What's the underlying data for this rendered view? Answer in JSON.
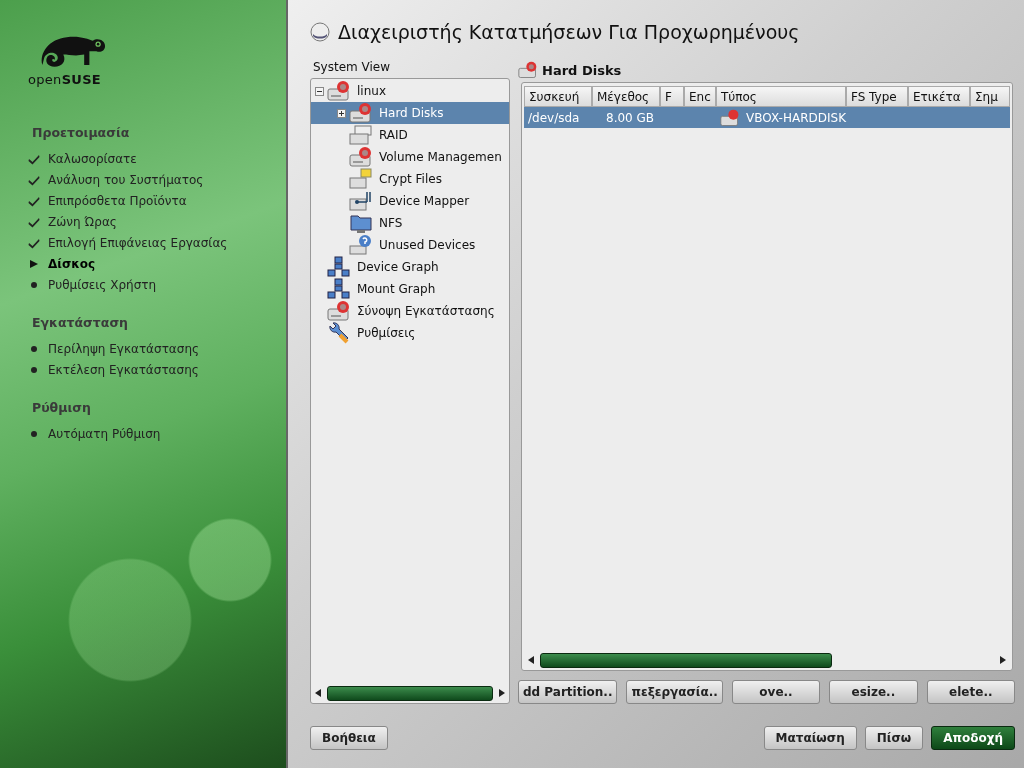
{
  "sidebar": {
    "logo_text": "open**SUSE**",
    "sections": [
      {
        "title": "Προετοιμασία",
        "items": [
          {
            "label": "Καλωσορίσατε",
            "done": true,
            "current": false
          },
          {
            "label": "Ανάλυση του Συστήματος",
            "done": true,
            "current": false
          },
          {
            "label": "Επιπρόσθετα Προϊόντα",
            "done": true,
            "current": false
          },
          {
            "label": "Ζώνη Ώρας",
            "done": true,
            "current": false
          },
          {
            "label": "Επιλογή Επιφάνειας Εργασίας",
            "done": true,
            "current": false
          },
          {
            "label": "Δίσκος",
            "done": false,
            "current": true
          },
          {
            "label": "Ρυθμίσεις Χρήστη",
            "done": false,
            "current": false
          }
        ]
      },
      {
        "title": "Εγκατάσταση",
        "items": [
          {
            "label": "Περίληψη Εγκατάστασης",
            "done": false,
            "current": false
          },
          {
            "label": "Εκτέλεση Εγκατάστασης",
            "done": false,
            "current": false
          }
        ]
      },
      {
        "title": "Ρύθμιση",
        "items": [
          {
            "label": "Αυτόματη Ρύθμιση",
            "done": false,
            "current": false
          }
        ]
      }
    ]
  },
  "window": {
    "title": "Διαχειριστής Κατατμήσεων Για Προχωρημένους"
  },
  "system_view": {
    "label": "System View",
    "tree": [
      {
        "label": "linux",
        "kind": "disk",
        "expanded": true,
        "selected": false,
        "children": [
          {
            "label": "Hard Disks",
            "kind": "disk",
            "expanded": false,
            "selected": true
          },
          {
            "label": "RAID",
            "kind": "raid",
            "selected": false
          },
          {
            "label": "Volume Managemen",
            "kind": "volume",
            "selected": false
          },
          {
            "label": "Crypt Files",
            "kind": "crypt",
            "selected": false
          },
          {
            "label": "Device Mapper",
            "kind": "mapper",
            "selected": false
          },
          {
            "label": "NFS",
            "kind": "nfs",
            "selected": false
          },
          {
            "label": "Unused Devices",
            "kind": "unused",
            "selected": false
          }
        ]
      },
      {
        "label": "Device Graph",
        "kind": "graph",
        "selected": false
      },
      {
        "label": "Mount Graph",
        "kind": "graph",
        "selected": false
      },
      {
        "label": "Σύνοψη Εγκατάστασης",
        "kind": "disk",
        "selected": false
      },
      {
        "label": "Ρυθμίσεις",
        "kind": "settings",
        "selected": false
      }
    ]
  },
  "detail": {
    "heading": "Hard Disks",
    "table": {
      "columns": [
        "Συσκευή",
        "Μέγεθος",
        "F",
        "Enc",
        "Τύπος",
        "FS Type",
        "Ετικέτα",
        "Σημ"
      ],
      "rows": [
        {
          "selected": true,
          "cells": [
            "/dev/sda",
            "8.00 GB",
            "",
            "",
            "VBOX-HARDDISK",
            "",
            "",
            ""
          ]
        }
      ]
    },
    "buttons": [
      "dd Partition..",
      "πεξεργασία..",
      "ove..",
      "esize..",
      "elete.."
    ]
  },
  "footer": {
    "help": "Βοήθεια",
    "cancel": "Ματαίωση",
    "back": "Πίσω",
    "accept": "Αποδοχή"
  }
}
